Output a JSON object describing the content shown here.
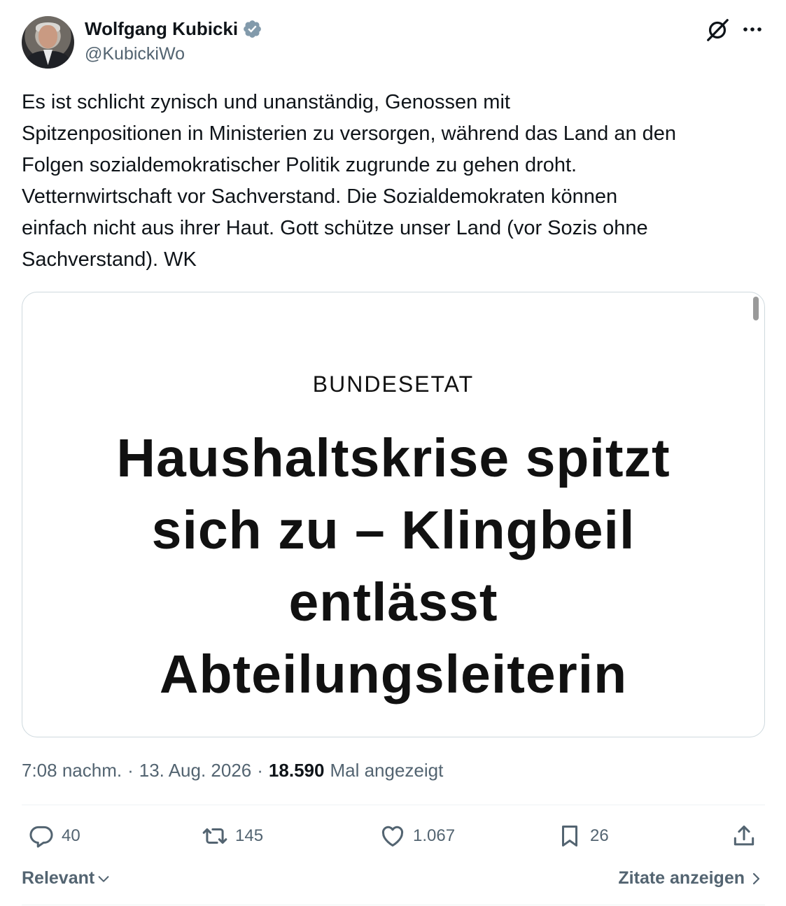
{
  "author": {
    "name": "Wolfgang Kubicki",
    "handle": "@KubickiWo"
  },
  "tweet": {
    "text": "Es ist schlicht zynisch und unanständig, Genossen mit\nSpitzenpositionen in Ministerien zu versorgen, während das Land an den\nFolgen sozialdemokratischer Politik zugrunde zu gehen droht.\nVetternwirtschaft vor Sachverstand. Die Sozialdemokraten können\neinfach nicht aus ihrer Haut. Gott schütze unser Land (vor Sozis ohne\nSachverstand). WK"
  },
  "media": {
    "kicker": "BUNDESETAT",
    "headline": "Haushaltskrise spitzt\nsich zu – Klingbeil\nentlässt\nAbteilungsleiterin"
  },
  "meta": {
    "time": "7:08 nachm.",
    "sep1": "·",
    "date": "13. Aug. 2026",
    "sep2": "·",
    "views_count": "18.590",
    "views_label": "Mal angezeigt"
  },
  "actions": {
    "replies": "40",
    "retweets": "145",
    "likes": "1.067",
    "bookmarks": "26"
  },
  "footer": {
    "sort_label": "Relevant",
    "quotes_label": "Zitate anzeigen"
  },
  "icons": {
    "verified": "verified-badge-icon",
    "grok": "grok-icon",
    "more": "more-icon",
    "reply": "reply-icon",
    "retweet": "retweet-icon",
    "like": "heart-icon",
    "bookmark": "bookmark-icon",
    "share": "share-icon"
  },
  "colors": {
    "verified_blue": "#829aab",
    "text_secondary": "#536471"
  }
}
